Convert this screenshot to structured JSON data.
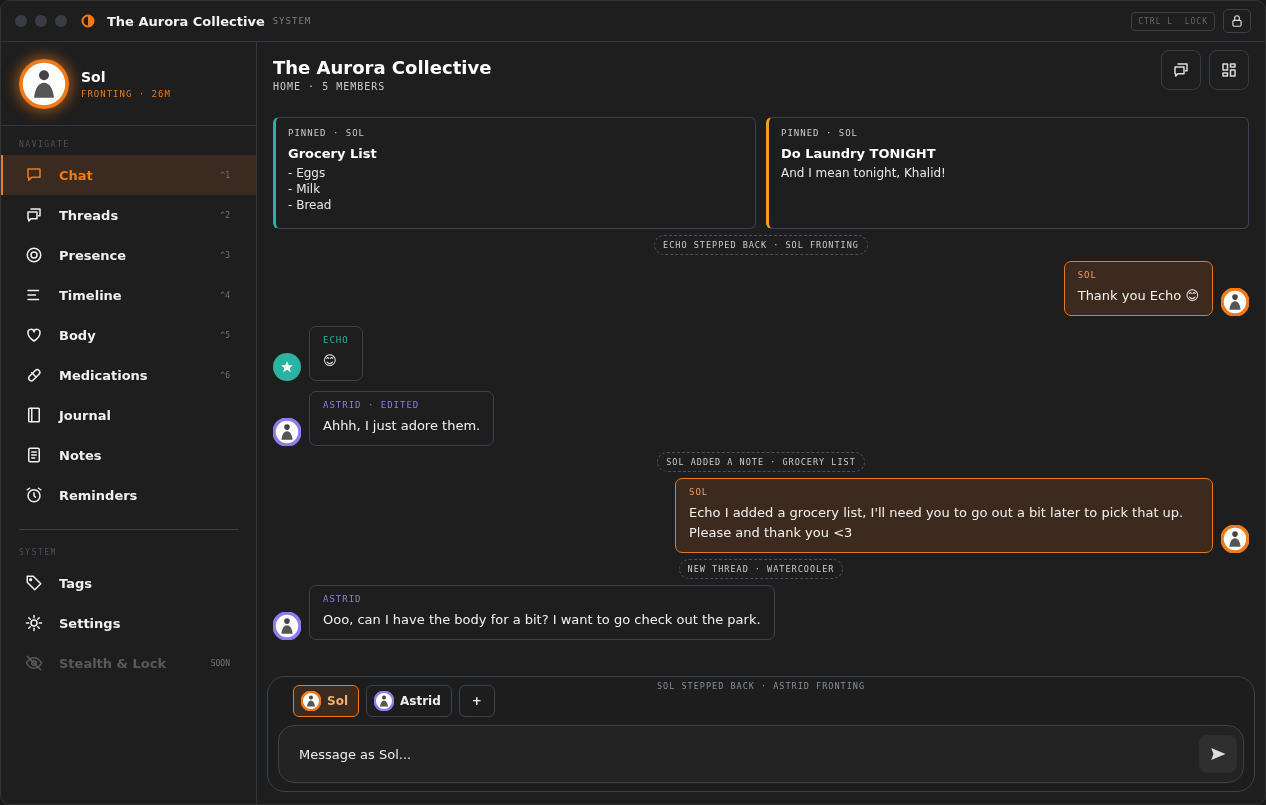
{
  "window": {
    "title": "The Aurora Collective",
    "subtitle": "SYSTEM",
    "shortcut": "CTRL L  LOCK"
  },
  "profile": {
    "name": "Sol",
    "status": "FRONTING · 26M"
  },
  "sidebar": {
    "sections": [
      {
        "heading": "NAVIGATE",
        "items": [
          {
            "label": "Chat",
            "shortcut": "^1",
            "selected": true,
            "disabled": false
          },
          {
            "label": "Threads",
            "shortcut": "^2",
            "selected": false,
            "disabled": false
          },
          {
            "label": "Presence",
            "shortcut": "^3",
            "selected": false,
            "disabled": false
          },
          {
            "label": "Timeline",
            "shortcut": "^4",
            "selected": false,
            "disabled": false
          },
          {
            "label": "Body",
            "shortcut": "^5",
            "selected": false,
            "disabled": false
          },
          {
            "label": "Medications",
            "shortcut": "^6",
            "selected": false,
            "disabled": false
          },
          {
            "label": "Journal",
            "selected": false,
            "disabled": false
          },
          {
            "label": "Notes",
            "selected": false,
            "disabled": false
          },
          {
            "label": "Reminders",
            "selected": false,
            "disabled": false
          }
        ]
      },
      {
        "heading": "SYSTEM",
        "items": [
          {
            "label": "Tags",
            "selected": false,
            "disabled": false
          },
          {
            "label": "Settings",
            "selected": false,
            "disabled": false
          },
          {
            "label": "Stealth & Lock",
            "shortcut": "SOON",
            "selected": false,
            "disabled": true
          }
        ]
      }
    ]
  },
  "header": {
    "title": "The Aurora Collective",
    "subtitle": "HOME · 5 MEMBERS"
  },
  "pinned": [
    {
      "meta": "PINNED · SOL",
      "title": "Grocery List",
      "lines": [
        "- Eggs",
        "- Milk",
        "- Bread"
      ],
      "color": "#1fb5a0"
    },
    {
      "meta": "PINNED · SOL",
      "title": "Do Laundry TONIGHT",
      "lines": [
        "And I mean tonight, Khalid!"
      ],
      "color": "#f0a020"
    }
  ],
  "messages": [
    {
      "kind": "event",
      "text": "ECHO STEPPED BACK · SOL FRONTING"
    },
    {
      "kind": "outgoing",
      "author": "SOL",
      "text": "Thank you Echo 😊",
      "avatar": {
        "kind": "photo"
      }
    },
    {
      "kind": "incoming",
      "author": "ECHO",
      "text": "😊",
      "color": "#2ab3a0",
      "avatar": {
        "kind": "star"
      }
    },
    {
      "kind": "incoming",
      "author": "ASTRID · EDITED",
      "text": "Ahhh, I just adore them.",
      "color": "#8d7cf0",
      "avatar": {
        "kind": "photo"
      }
    },
    {
      "kind": "event",
      "text": "SOL ADDED A NOTE · GROCERY LIST"
    },
    {
      "kind": "outgoing",
      "author": "SOL",
      "text": "Echo I added a grocery list, I'll need you to go out a bit later to pick that up. Please and thank you <3",
      "avatar": {
        "kind": "photo"
      }
    },
    {
      "kind": "event",
      "text": "NEW THREAD · WATERCOOLER"
    },
    {
      "kind": "incoming",
      "author": "ASTRID",
      "text": "Ooo, can I have the body for a bit? I want to go check out the park.",
      "color": "#8d7cf0",
      "avatar": {
        "kind": "photo"
      }
    }
  ],
  "composer": {
    "faint_event": "SOL STEPPED BACK · ASTRID FRONTING",
    "members": [
      {
        "name": "Sol",
        "selected": true,
        "color": "#f07a1a"
      },
      {
        "name": "Astrid",
        "selected": false,
        "color": "#8d7cf0"
      }
    ],
    "add": "+",
    "placeholder": "Message as Sol..."
  }
}
